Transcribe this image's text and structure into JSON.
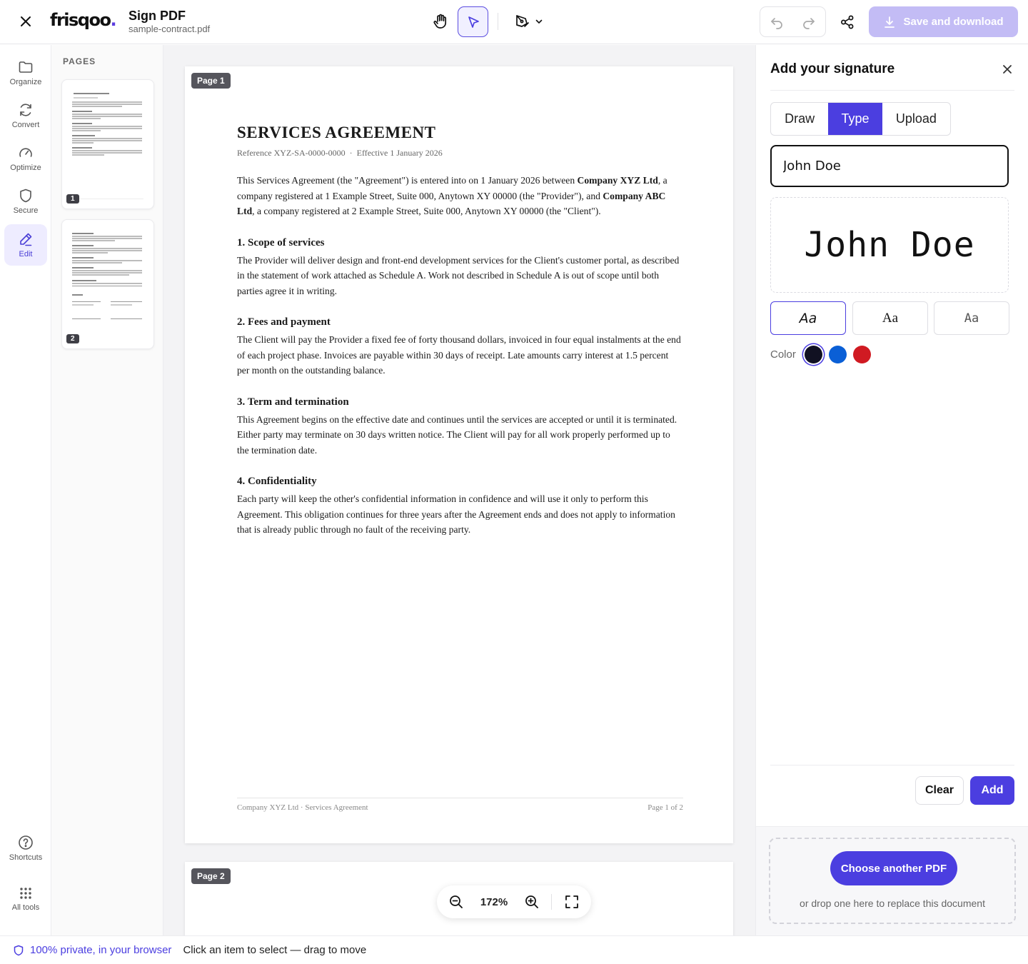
{
  "header": {
    "logo_text": "frisqoo",
    "logo_dot": ".",
    "app_title": "Sign PDF",
    "file_name": "sample-contract.pdf",
    "save_label": "Save and download"
  },
  "rail": {
    "items": [
      {
        "label": "Organize",
        "icon": "folder-icon"
      },
      {
        "label": "Convert",
        "icon": "refresh-icon"
      },
      {
        "label": "Optimize",
        "icon": "gauge-icon"
      },
      {
        "label": "Secure",
        "icon": "shield-icon"
      },
      {
        "label": "Edit",
        "icon": "pen-icon"
      },
      {
        "label": "Shortcuts",
        "icon": "help-circle-icon"
      },
      {
        "label": "All tools",
        "icon": "grid-icon"
      }
    ]
  },
  "pages_panel": {
    "heading": "PAGES",
    "thumbs": [
      "1",
      "2"
    ]
  },
  "document": {
    "page1_tag": "Page 1",
    "page2_tag": "Page 2",
    "title": "SERVICES AGREEMENT",
    "reference": "Reference XYZ-SA-0000-0000",
    "ref_sep": "·",
    "effective": "Effective 1 January 2026",
    "intro": {
      "t1": "This Services Agreement (the \"Agreement\") is entered into on 1 January 2026 between ",
      "b1": "Company XYZ Ltd",
      "t2": ", a company registered at 1 Example Street, Suite 000, Anytown XY 00000 (the \"Provider\"), and ",
      "b2": "Company ABC Ltd",
      "t3": ", a company registered at 2 Example Street, Suite 000, Anytown XY 00000 (the \"Client\")."
    },
    "sections": [
      {
        "heading": "1. Scope of services",
        "body": "The Provider will deliver design and front-end development services for the Client's customer portal, as described in the statement of work attached as Schedule A. Work not described in Schedule A is out of scope until both parties agree it in writing."
      },
      {
        "heading": "2. Fees and payment",
        "body": "The Client will pay the Provider a fixed fee of forty thousand dollars, invoiced in four equal instalments at the end of each project phase. Invoices are payable within 30 days of receipt. Late amounts carry interest at 1.5 percent per month on the outstanding balance."
      },
      {
        "heading": "3. Term and termination",
        "body": "This Agreement begins on the effective date and continues until the services are accepted or until it is terminated. Either party may terminate on 30 days written notice. The Client will pay for all work properly performed up to the termination date."
      },
      {
        "heading": "4. Confidentiality",
        "body": "Each party will keep the other's confidential information in confidence and will use it only to perform this Agreement. This obligation continues for three years after the Agreement ends and does not apply to information that is already public through no fault of the receiving party."
      }
    ],
    "footer_left": "Company XYZ Ltd · Services Agreement",
    "footer_right": "Page 1 of 2"
  },
  "zoom": {
    "value": "172%"
  },
  "signature_panel": {
    "title": "Add your signature",
    "tabs": {
      "draw": "Draw",
      "type": "Type",
      "upload": "Upload"
    },
    "active_tab": "Type",
    "input_value": "John Doe",
    "preview_text": "John Doe",
    "font_options": [
      "Aa",
      "Aa",
      "Aa"
    ],
    "color_label": "Color",
    "colors": [
      "#111122",
      "#0a5fd6",
      "#d01a22"
    ],
    "selected_color": "#111122",
    "clear_label": "Clear",
    "add_label": "Add",
    "choose_label": "Choose another PDF",
    "drop_hint": "or drop one here to replace this document"
  },
  "status": {
    "privacy": "100% private, in your browser",
    "hint": "Click an item to select — drag to move"
  },
  "colors": {
    "accent": "#4b3ee0",
    "save_disabled": "#c3bcf5"
  }
}
